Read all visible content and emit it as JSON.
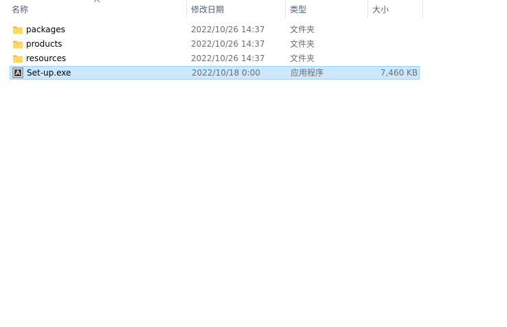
{
  "columns": {
    "name": "名称",
    "date": "修改日期",
    "type": "类型",
    "size": "大小"
  },
  "files": [
    {
      "name": "packages",
      "date": "2022/10/26 14:37",
      "type": "文件夹",
      "size": "",
      "icon": "folder-icon"
    },
    {
      "name": "products",
      "date": "2022/10/26 14:37",
      "type": "文件夹",
      "size": "",
      "icon": "folder-icon"
    },
    {
      "name": "resources",
      "date": "2022/10/26 14:37",
      "type": "文件夹",
      "size": "",
      "icon": "folder-icon"
    },
    {
      "name": "Set-up.exe",
      "date": "2022/10/18 0:00",
      "type": "应用程序",
      "size": "7,460 KB",
      "icon": "adobe-app-icon",
      "selected": true
    }
  ],
  "colors": {
    "header_text": "#4c607a",
    "selection_fill": "#cce8ff",
    "selection_border": "#99d1ff",
    "folder": "#ffd767"
  }
}
